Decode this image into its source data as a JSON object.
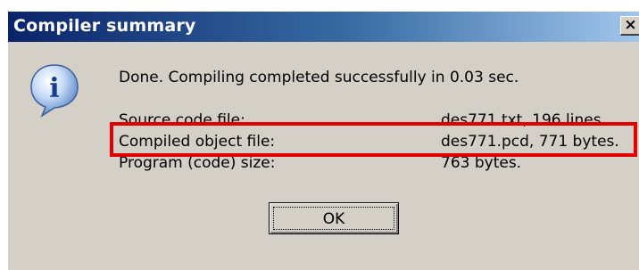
{
  "window": {
    "title": "Compiler summary",
    "close_symbol": "×"
  },
  "icon": {
    "name": "info-icon",
    "glyph": "i"
  },
  "message": "Done. Compiling completed successfully in 0.03 sec.",
  "details": [
    {
      "label": "Source code file:",
      "value": "des771.txt, 196 lines."
    },
    {
      "label": "Compiled object file:",
      "value": "des771.pcd, 771 bytes."
    },
    {
      "label": "Program (code) size:",
      "value": "763 bytes."
    }
  ],
  "buttons": {
    "ok_label": "OK"
  },
  "colors": {
    "title_gradient_start": "#0a246a",
    "title_gradient_end": "#a6caf0",
    "dialog_bg": "#d4d0c8",
    "highlight": "#e00000"
  }
}
